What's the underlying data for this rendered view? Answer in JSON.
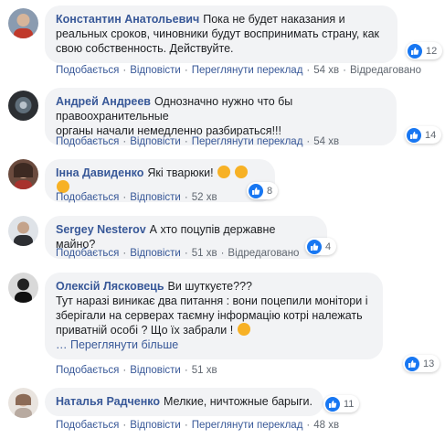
{
  "comments": [
    {
      "author": "Константин Анатольевич",
      "text": "Пока не будет наказания и\nреальных сроков, чиновники будут воспринимать страну, как\nсвою собственность. Действуйте.",
      "reactions": "12",
      "actions": {
        "like": "Подобається",
        "reply": "Відповісти",
        "translate": "Переглянути переклад",
        "time": "54 хв",
        "edited": "Відредаговано"
      }
    },
    {
      "author": "Андрей Андреев",
      "text": "Однозначно нужно что бы правоохранительные\nорганы начали немедленно разбираться!!!",
      "reactions": "14",
      "actions": {
        "like": "Подобається",
        "reply": "Відповісти",
        "translate": "Переглянути переклад",
        "time": "54 хв"
      }
    },
    {
      "author": "Інна Давиденко",
      "text": "Які тварюки!",
      "reactions": "8",
      "actions": {
        "like": "Подобається",
        "reply": "Відповісти",
        "time": "52 хв"
      }
    },
    {
      "author": "Sergey Nesterov",
      "text": "А хто поцупів державне майно?",
      "reactions": "4",
      "actions": {
        "like": "Подобається",
        "reply": "Відповісти",
        "time": "51 хв",
        "edited": "Відредаговано"
      }
    },
    {
      "author": "Олексій Лясковець",
      "text": "Ви шуткуєте???\nТут наразі виникає два питання : вони поцепили монітори і\nзберігали на серверах таємну інформацію котрі належать\nприватній особі ? Що їх забрали !",
      "more": "… Переглянути більше",
      "reactions": "13",
      "actions": {
        "like": "Подобається",
        "reply": "Відповісти",
        "time": "51 хв"
      }
    },
    {
      "author": "Наталья Радченко",
      "text": "Мелкие, ничтожные барыги.",
      "reactions": "11",
      "actions": {
        "like": "Подобається",
        "reply": "Відповісти",
        "translate": "Переглянути переклад",
        "time": "48 хв"
      }
    }
  ],
  "icons": {
    "like": "thumbs-up-icon",
    "angry": "angry-face-icon",
    "thinking": "thinking-face-icon"
  },
  "colors": {
    "link": "#385898",
    "bubble": "#f2f3f5",
    "like": "#1877f2",
    "meta": "#606770"
  }
}
